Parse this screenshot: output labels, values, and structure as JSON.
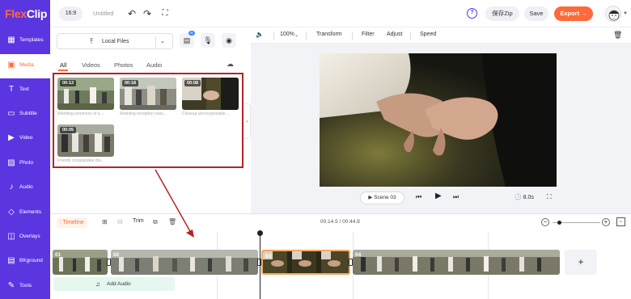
{
  "app": {
    "logo_part1": "Flex",
    "logo_part2": "Clip",
    "ratio": "16:9",
    "title": "Untitled"
  },
  "header": {
    "undo_icon": "undo-icon",
    "redo_icon": "redo-icon",
    "fullscreen_icon": "expand-icon",
    "help": "?",
    "zip_label": "保存Zip",
    "save_label": "Save",
    "export_label": "Export →"
  },
  "sidebar": {
    "items": [
      {
        "label": "Templates",
        "icon": "templates-icon",
        "glyph": "▦"
      },
      {
        "label": "Media",
        "icon": "media-icon",
        "glyph": "▣"
      },
      {
        "label": "Text",
        "icon": "text-icon",
        "glyph": "T"
      },
      {
        "label": "Subtitle",
        "icon": "subtitle-icon",
        "glyph": "▭"
      },
      {
        "label": "Video",
        "icon": "video-icon",
        "glyph": "▶"
      },
      {
        "label": "Photo",
        "icon": "photo-icon",
        "glyph": "▨"
      },
      {
        "label": "Audio",
        "icon": "audio-icon",
        "glyph": "♪"
      },
      {
        "label": "Elements",
        "icon": "elements-icon",
        "glyph": "◇"
      },
      {
        "label": "Overlays",
        "icon": "overlays-icon",
        "glyph": "◫"
      },
      {
        "label": "BKground",
        "icon": "background-icon",
        "glyph": "▤"
      },
      {
        "label": "Tools",
        "icon": "tools-icon",
        "glyph": "✎"
      }
    ],
    "active_index": 1
  },
  "media": {
    "upload_label": "Local Files",
    "new_badge": "N",
    "tabs": [
      "All",
      "Videos",
      "Photos",
      "Audio"
    ],
    "active_tab": "All",
    "items": [
      {
        "duration": "00:13",
        "caption": "Wedding ceremony of a ..."
      },
      {
        "duration": "00:18",
        "caption": "Wedding reception outsi..."
      },
      {
        "duration": "00:08",
        "caption": "Closeup unrecognizable ..."
      },
      {
        "duration": "00:05",
        "caption": "Friends congratulate the..."
      }
    ]
  },
  "preview": {
    "zoom": "100%",
    "tools": [
      "Transform",
      "Filter",
      "Adjust",
      "Speed"
    ],
    "scene_label": "Scene 03",
    "duration": "8.0s"
  },
  "timeline": {
    "label": "Timeline",
    "trim_label": "Trim",
    "time": "00:14.5 / 00:44.9",
    "clips": [
      "01",
      "02",
      "03",
      "04"
    ],
    "selected_clip": "03",
    "add_audio_label": "Add Audio",
    "add_clip": "+"
  },
  "colors": {
    "brand": "#5b35e0",
    "accent": "#ff6a3d",
    "annotation": "#b52327"
  }
}
